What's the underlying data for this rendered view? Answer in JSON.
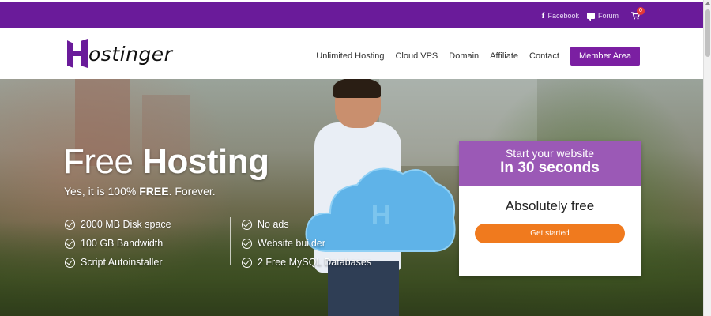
{
  "topbar": {
    "links": [
      {
        "label": "Facebook",
        "icon": "facebook-icon"
      },
      {
        "label": "Forum",
        "icon": "forum-icon"
      }
    ],
    "cart_count": "0"
  },
  "header": {
    "logo_text": "ostinger",
    "nav": [
      "Unlimited Hosting",
      "Cloud VPS",
      "Domain",
      "Affiliate",
      "Contact"
    ],
    "member_button": "Member Area"
  },
  "hero": {
    "title_light": "Free",
    "title_bold": "Hosting",
    "subtitle_pre": "Yes, it is 100% ",
    "subtitle_bold": "FREE",
    "subtitle_post": ". Forever.",
    "features_col1": [
      "2000 MB Disk space",
      "100 GB Bandwidth",
      "Script Autoinstaller"
    ],
    "features_col2": [
      "No ads",
      "Website builder",
      "2 Free MySQL Databases"
    ]
  },
  "card": {
    "line1": "Start your website",
    "line2": "In 30 seconds",
    "free_label": "Absolutely free",
    "cta": "Get started"
  },
  "colors": {
    "brand_purple": "#6a1b9a",
    "card_purple": "#9b59b6",
    "cta_orange": "#f07a1e"
  }
}
